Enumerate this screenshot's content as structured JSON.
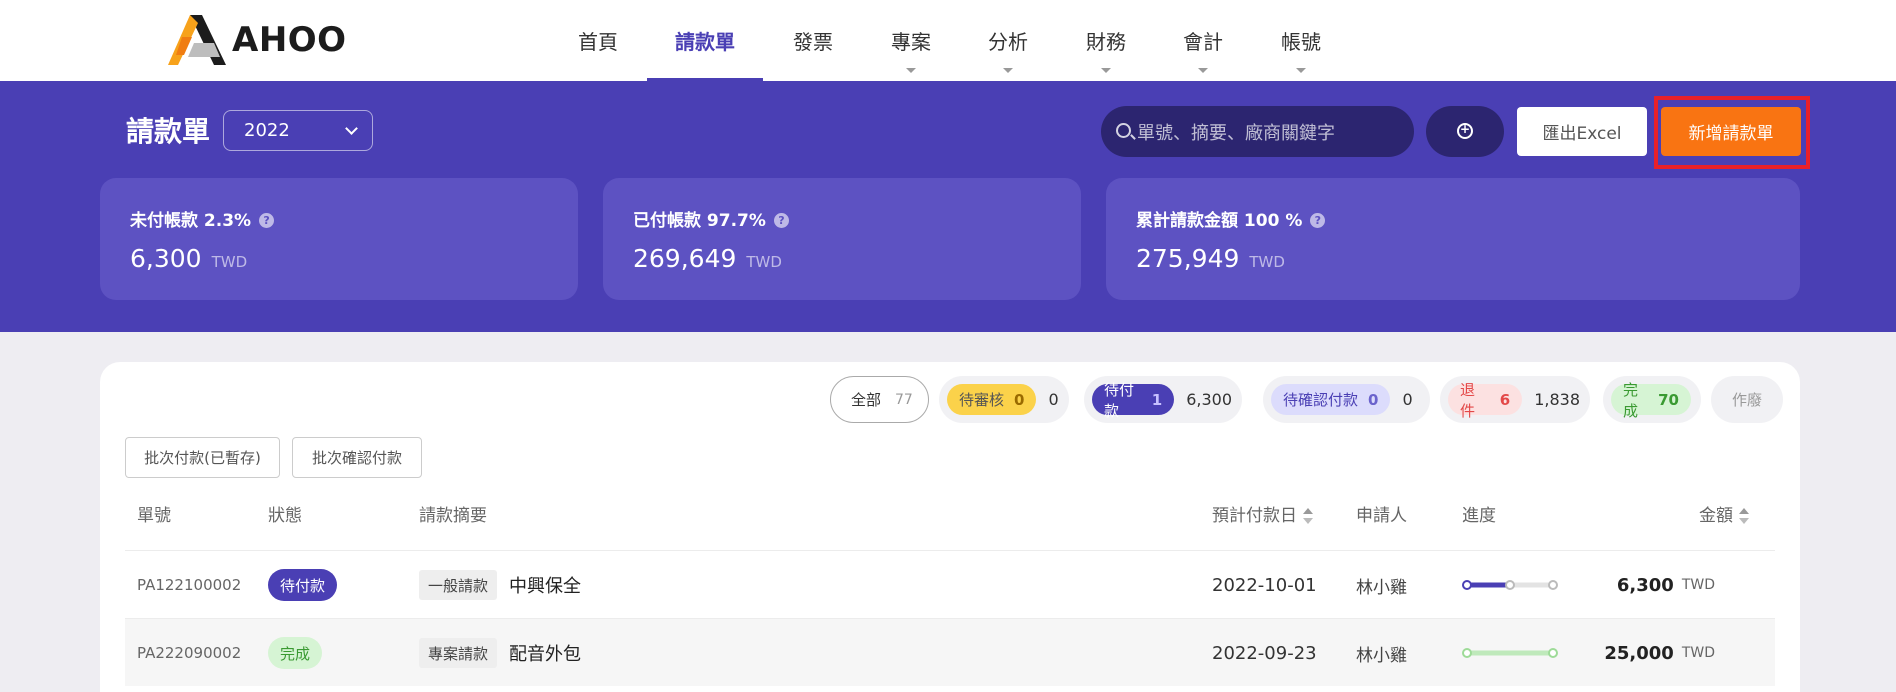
{
  "brand": {
    "name": "AHOO"
  },
  "nav": [
    {
      "label": "首頁",
      "active": false,
      "dropdown": false
    },
    {
      "label": "請款單",
      "active": true,
      "dropdown": false
    },
    {
      "label": "發票",
      "active": false,
      "dropdown": false
    },
    {
      "label": "專案",
      "active": false,
      "dropdown": true
    },
    {
      "label": "分析",
      "active": false,
      "dropdown": true
    },
    {
      "label": "財務",
      "active": false,
      "dropdown": true
    },
    {
      "label": "會計",
      "active": false,
      "dropdown": true
    },
    {
      "label": "帳號",
      "active": false,
      "dropdown": true
    }
  ],
  "header": {
    "title": "請款單",
    "year": "2022",
    "search_placeholder": "單號、摘要、廠商關鍵字",
    "export_label": "匯出Excel",
    "new_label": "新增請款單"
  },
  "stats": [
    {
      "label": "未付帳款 2.3%",
      "value": "6,300",
      "unit": "TWD"
    },
    {
      "label": "已付帳款 97.7%",
      "value": "269,649",
      "unit": "TWD"
    },
    {
      "label": "累計請款金額 100 %",
      "value": "275,949",
      "unit": "TWD"
    }
  ],
  "filters": {
    "all": {
      "label": "全部",
      "count": "77"
    },
    "pending_review": {
      "label": "待審核",
      "count": "0",
      "amount": "0"
    },
    "pending_payment": {
      "label": "待付款",
      "count": "1",
      "amount": "6,300"
    },
    "pending_confirm": {
      "label": "待確認付款",
      "count": "0",
      "amount": "0"
    },
    "returned": {
      "label": "退件",
      "count": "6",
      "amount": "1,838"
    },
    "done": {
      "label": "完成",
      "count": "70"
    },
    "void": {
      "label": "作廢"
    }
  },
  "batch": {
    "batch_pay": "批次付款(已暫存)",
    "batch_confirm": "批次確認付款"
  },
  "table": {
    "headers": {
      "id": "單號",
      "status": "狀態",
      "summary": "請款摘要",
      "due_date": "預計付款日",
      "applicant": "申請人",
      "progress": "進度",
      "amount": "金額"
    },
    "rows": [
      {
        "id": "PA122100002",
        "status": "待付款",
        "category": "一般請款",
        "summary": "中興保全",
        "due_date": "2022-10-01",
        "applicant": "林小雞",
        "progress_step": 2,
        "progress_total": 3,
        "amount": "6,300",
        "unit": "TWD"
      },
      {
        "id": "PA222090002",
        "status": "完成",
        "category": "專案請款",
        "summary": "配音外包",
        "due_date": "2022-09-23",
        "applicant": "林小雞",
        "progress_step": 3,
        "progress_total": 3,
        "amount": "25,000",
        "unit": "TWD"
      }
    ]
  },
  "colors": {
    "brand_purple": "#4a3fb4",
    "orange": "#f97412",
    "highlight_red": "#e8202a",
    "done_green": "#3a9a32"
  }
}
